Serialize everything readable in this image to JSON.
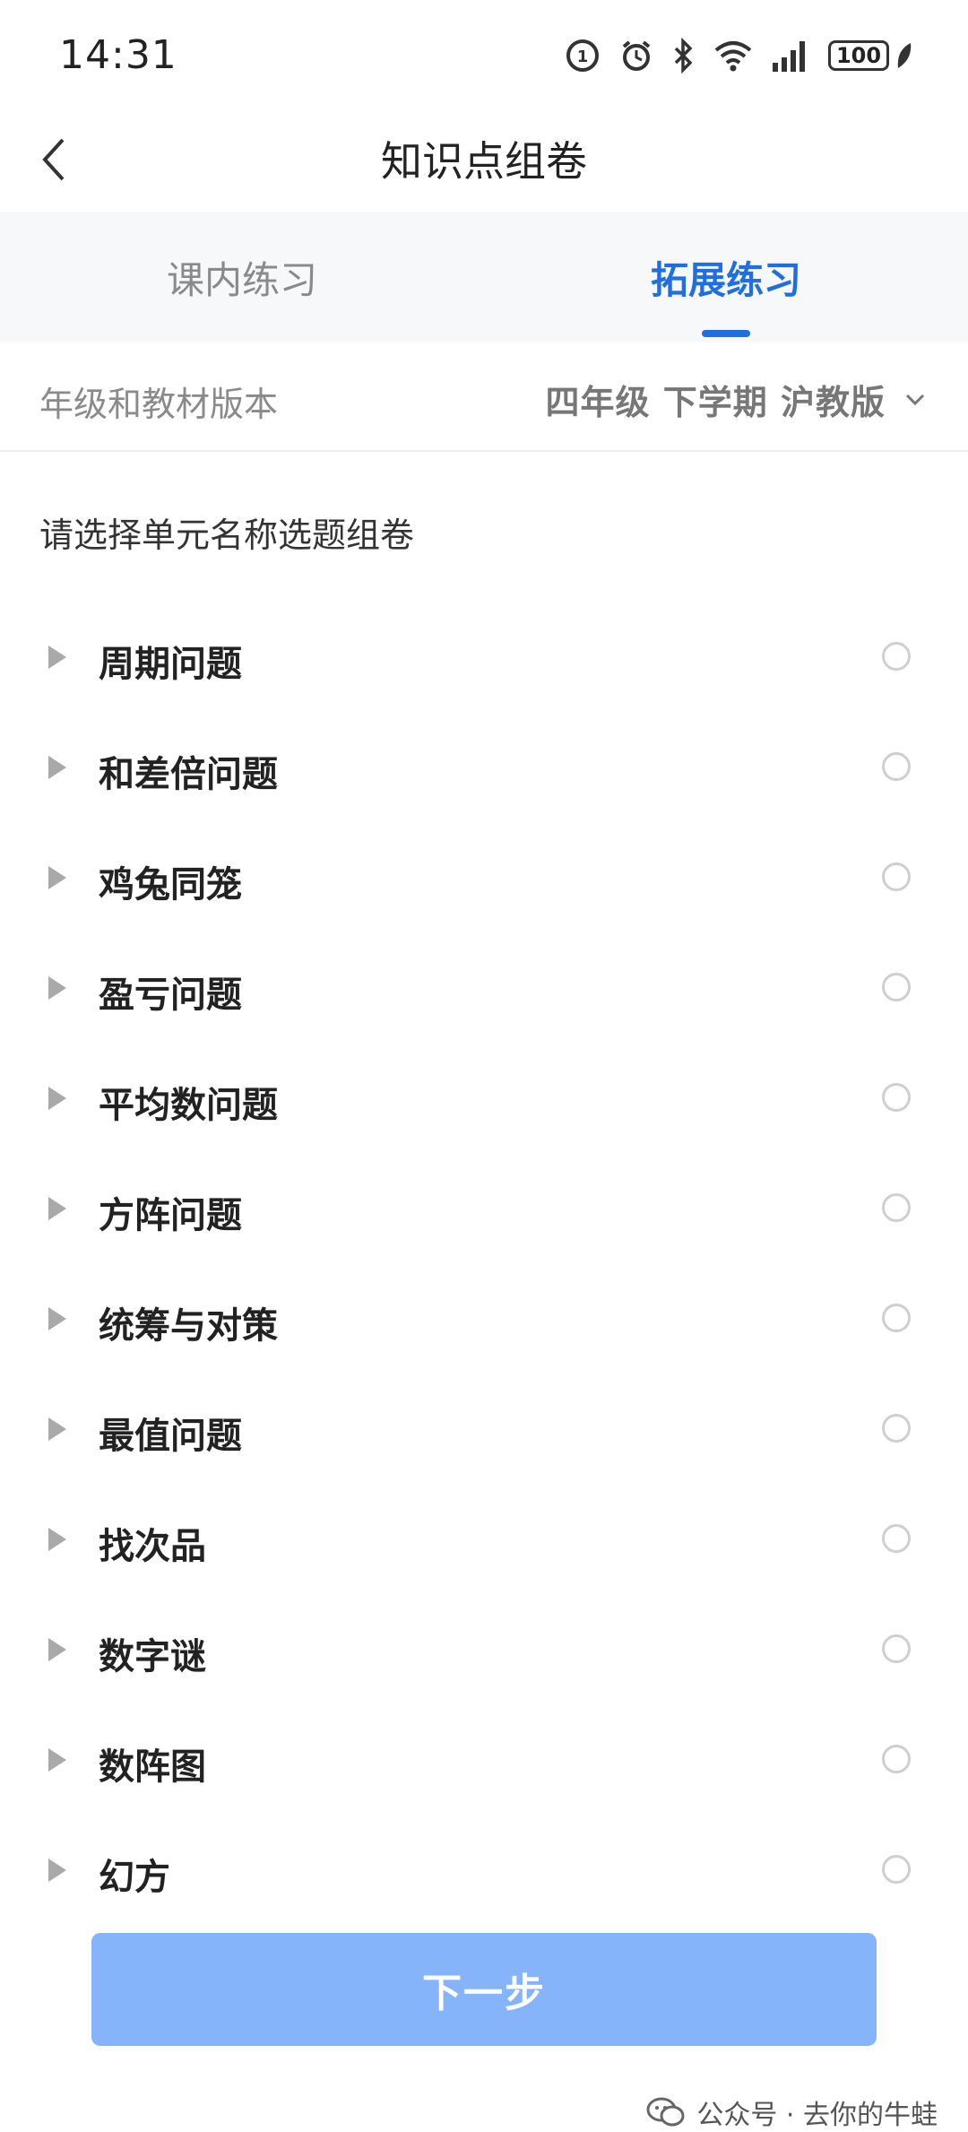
{
  "status_bar": {
    "time": "14:31",
    "battery": "100",
    "icons": [
      "hd-call-icon",
      "alarm-icon",
      "bluetooth-icon",
      "wifi-icon",
      "signal-icon",
      "battery-icon",
      "leaf-icon"
    ]
  },
  "header": {
    "title": "知识点组卷",
    "back_icon": "chevron-left-icon"
  },
  "tabs": [
    {
      "label": "课内练习",
      "active": false
    },
    {
      "label": "拓展练习",
      "active": true
    }
  ],
  "grade": {
    "label": "年级和教材版本",
    "value": "四年级 下学期 沪教版",
    "icon": "chevron-down-icon"
  },
  "instruction": "请选择单元名称选题组卷",
  "units": [
    {
      "name": "周期问题"
    },
    {
      "name": "和差倍问题"
    },
    {
      "name": "鸡兔同笼"
    },
    {
      "name": "盈亏问题"
    },
    {
      "name": "平均数问题"
    },
    {
      "name": "方阵问题"
    },
    {
      "name": "统筹与对策"
    },
    {
      "name": "最值问题"
    },
    {
      "name": "找次品"
    },
    {
      "name": "数字谜"
    },
    {
      "name": "数阵图"
    },
    {
      "name": "幻方"
    }
  ],
  "next_button": {
    "label": "下一步"
  },
  "watermark": {
    "text": "公众号 · 去你的牛蛙",
    "icon": "wechat-icon"
  },
  "colors": {
    "accent": "#1f6fe0",
    "button_disabled": "#85b4fb",
    "muted_text": "#8a8a8a",
    "tab_background": "#f7f8fa"
  }
}
